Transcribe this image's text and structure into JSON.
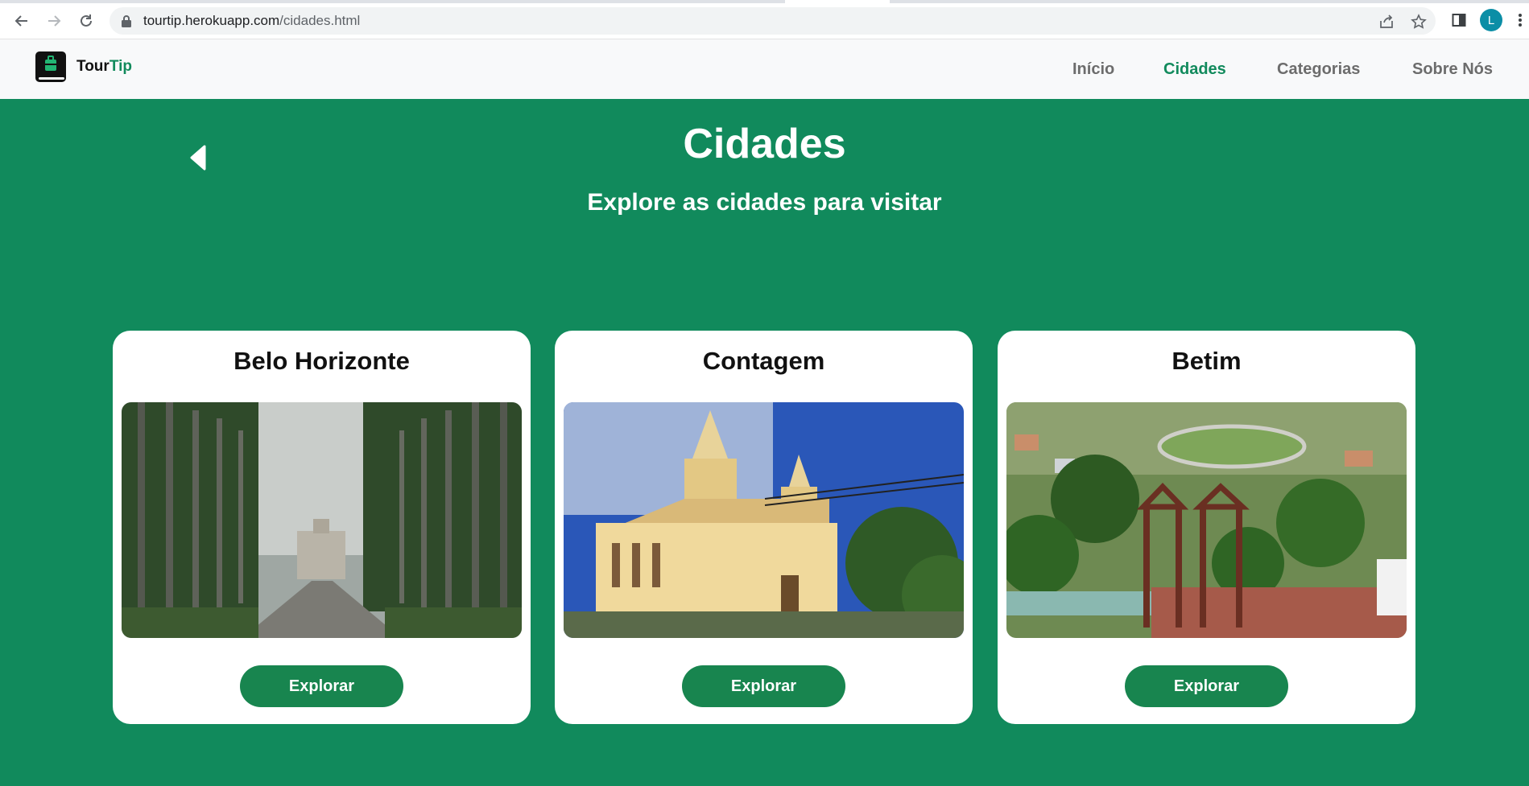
{
  "browser": {
    "url_host": "tourtip.herokuapp.com",
    "url_path": "/cidades.html",
    "avatar_letter": "L"
  },
  "site": {
    "brand_primary": "Tour",
    "brand_accent": "Tip",
    "nav": [
      {
        "label": "Início",
        "active": false
      },
      {
        "label": "Cidades",
        "active": true
      },
      {
        "label": "Categorias",
        "active": false
      },
      {
        "label": "Sobre Nós",
        "active": false
      }
    ]
  },
  "main": {
    "title": "Cidades",
    "subtitle": "Explore as cidades para visitar",
    "cards": [
      {
        "title": "Belo Horizonte",
        "button": "Explorar"
      },
      {
        "title": "Contagem",
        "button": "Explorar"
      },
      {
        "title": "Betim",
        "button": "Explorar"
      }
    ]
  },
  "colors": {
    "accent_green": "#118a5c",
    "button_green": "#18854f",
    "nav_bg": "#f8f9fa",
    "nav_text": "#6c6c6c"
  }
}
